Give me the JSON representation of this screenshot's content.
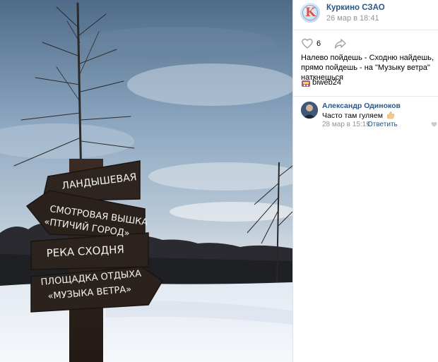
{
  "post": {
    "group_name": "Куркино СЗАО",
    "date": "26 мар в 18:41",
    "likes": "6",
    "text": "Налево пойдешь - Сходню найдешь, прямо пойдешь - на \"Музыку ветра\" наткнешься",
    "author_tag": "biweb24"
  },
  "comment": {
    "author": "Александр Одиноков",
    "text": "Часто там гуляем",
    "date": "28 мар в 15:19",
    "reply_label": "Ответить"
  },
  "photo": {
    "signs": [
      "ЛАНДЫШЕВАЯ",
      "СМОТРОВАЯ ВЫШКА",
      "«ПТИЧИЙ ГОРОД»",
      "РЕКА СХОДНЯ",
      "ПЛОЩАДКА ОТДЫХА",
      "«МУЗЫКА ВЕТРА»"
    ]
  },
  "colors": {
    "link": "#2a5885",
    "muted": "#939393",
    "divider": "#dce1e6"
  },
  "icons": {
    "like": "heart-icon",
    "share": "share-arrow-icon",
    "comment_like": "heart-icon",
    "tag_emoji": "emoji-icon",
    "comment_emoji": "thumbs-up-icon"
  }
}
